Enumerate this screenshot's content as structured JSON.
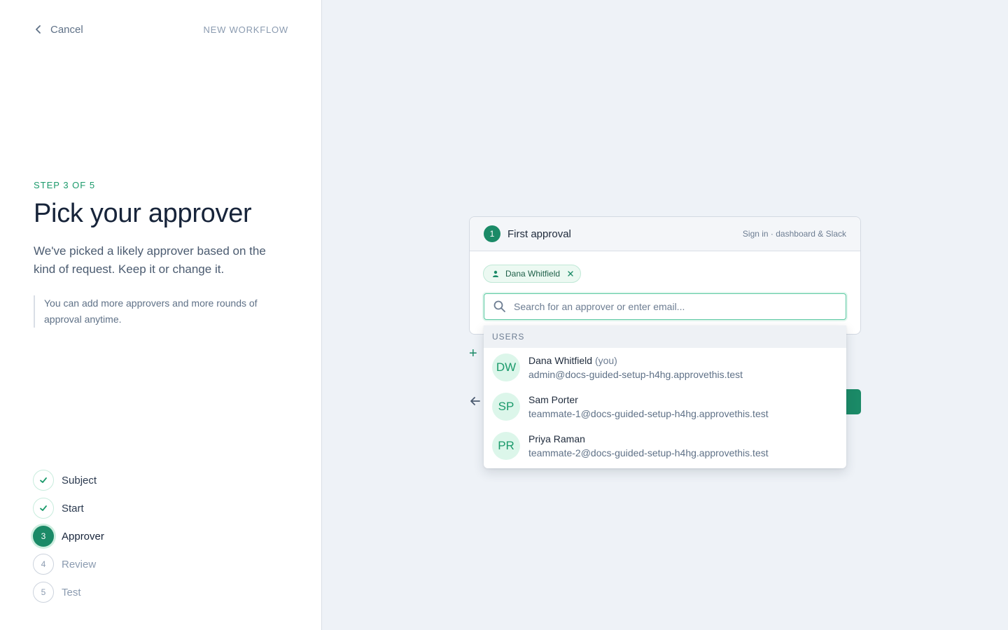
{
  "header": {
    "cancel_label": "Cancel",
    "workflow_label": "NEW WORKFLOW"
  },
  "intro": {
    "step_label": "STEP 3 OF 5",
    "title": "Pick your approver",
    "description": "We've picked a likely approver based on the kind of request. Keep it or change it.",
    "note": "You can add more approvers and more rounds of approval anytime."
  },
  "steps": [
    {
      "number": "1",
      "label": "Subject",
      "state": "done"
    },
    {
      "number": "2",
      "label": "Start",
      "state": "done"
    },
    {
      "number": "3",
      "label": "Approver",
      "state": "active"
    },
    {
      "number": "4",
      "label": "Review",
      "state": "todo"
    },
    {
      "number": "5",
      "label": "Test",
      "state": "todo"
    }
  ],
  "approval_card": {
    "round_number": "1",
    "title": "First approval",
    "meta": "Sign in · dashboard & Slack",
    "selected_chip": "Dana Whitfield",
    "search_placeholder": "Search for an approver or enter email...",
    "search_value": ""
  },
  "dropdown": {
    "section_label": "USERS",
    "users": [
      {
        "initials": "DW",
        "name": "Dana Whitfield",
        "suffix": "(you)",
        "email": "admin@docs-guided-setup-h4hg.approvethis.test"
      },
      {
        "initials": "SP",
        "name": "Sam Porter",
        "suffix": "",
        "email": "teammate-1@docs-guided-setup-h4hg.approvethis.test"
      },
      {
        "initials": "PR",
        "name": "Priya Raman",
        "suffix": "",
        "email": "teammate-2@docs-guided-setup-h4hg.approvethis.test"
      }
    ]
  },
  "icons": {
    "cancel": "chevron-left-icon",
    "done_step": "check-icon",
    "chip_user": "user-icon",
    "chip_remove": "close-icon",
    "search": "search-icon",
    "add_round": "plus-icon",
    "back": "arrow-left-icon"
  },
  "colors": {
    "accent": "#1b8a67",
    "accent_light": "#dcf6ea",
    "panel_bg": "#ffffff",
    "canvas_bg": "#eef2f7"
  }
}
